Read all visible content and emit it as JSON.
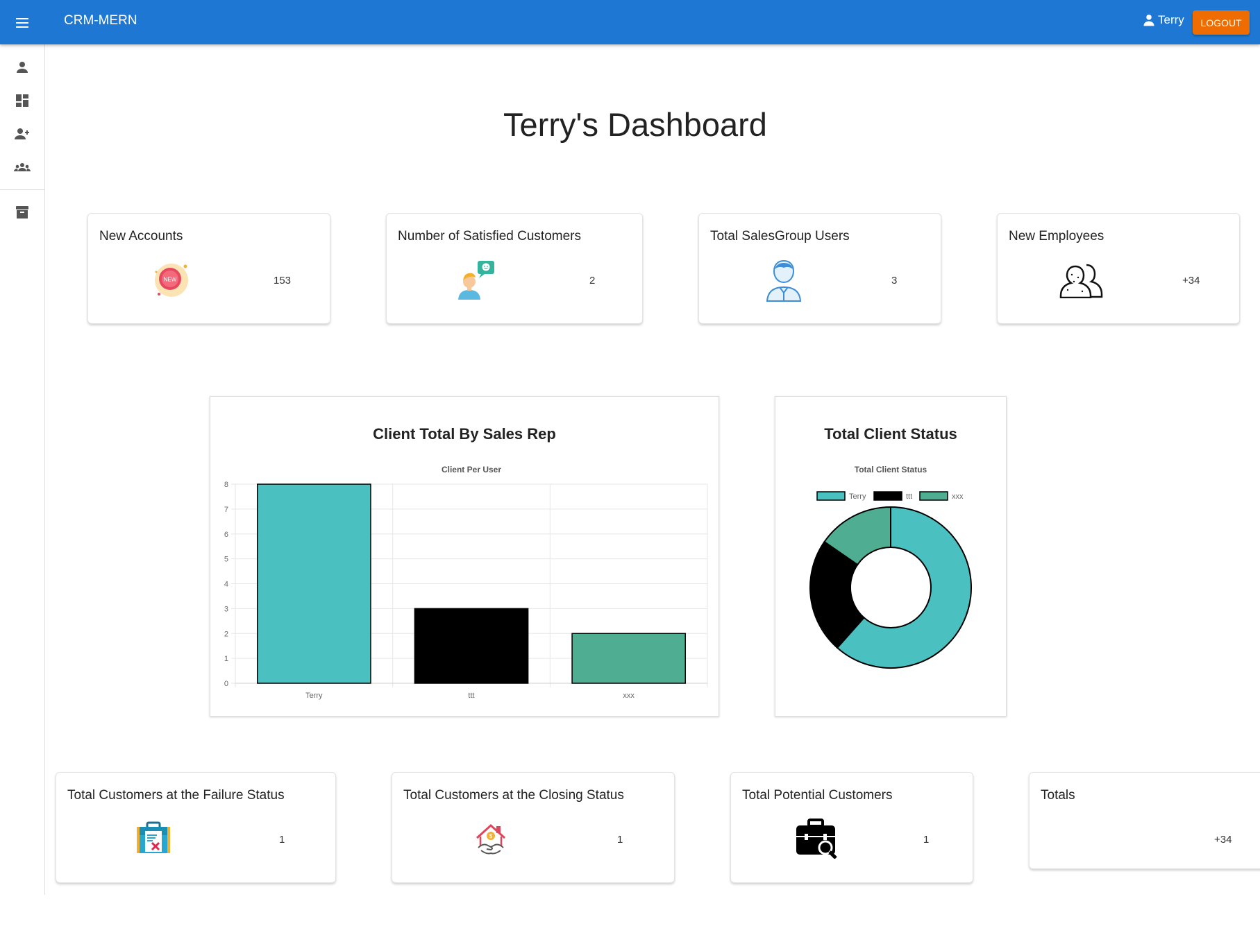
{
  "app": {
    "title": "CRM-MERN",
    "user_name": "Terry",
    "logout_label": "LOGOUT",
    "brand_color": "#1e78d3",
    "logout_color": "#ef6c00"
  },
  "sidebar": {
    "items": [
      {
        "icon": "person-icon"
      },
      {
        "icon": "dashboard-icon"
      },
      {
        "icon": "person-add-icon"
      },
      {
        "icon": "groups-icon"
      },
      {
        "icon": "archive-icon"
      }
    ]
  },
  "page": {
    "title": "Terry's Dashboard"
  },
  "stats_top": [
    {
      "label": "New Accounts",
      "value": "153",
      "icon": "new-badge-icon"
    },
    {
      "label": "Number of Satisfied Customers",
      "value": "2",
      "icon": "satisfied-customer-icon"
    },
    {
      "label": "Total SalesGroup Users",
      "value": "3",
      "icon": "user-icon"
    },
    {
      "label": "New Employees",
      "value": "+34",
      "icon": "employees-icon"
    }
  ],
  "stats_bottom": [
    {
      "label": "Total Customers at the Failure Status",
      "value": "1",
      "icon": "failure-briefcase-icon"
    },
    {
      "label": "Total Customers at the Closing Status",
      "value": "1",
      "icon": "closing-deal-icon"
    },
    {
      "label": "Total Potential Customers",
      "value": "1",
      "icon": "potential-briefcase-icon"
    },
    {
      "label": "Totals",
      "value": "+34",
      "icon": ""
    }
  ],
  "charts": {
    "bar_heading": "Client Total By Sales Rep",
    "pie_heading": "Total Client Status"
  },
  "chart_data": [
    {
      "type": "bar",
      "title": "Client Per User",
      "categories": [
        "Terry",
        "ttt",
        "xxx"
      ],
      "values": [
        8,
        3,
        2
      ],
      "colors": [
        "#4bc0c0",
        "#000000",
        "#4fad91"
      ],
      "ylim": [
        0,
        8
      ],
      "yticks": [
        0,
        1,
        2,
        3,
        4,
        5,
        6,
        7,
        8
      ],
      "grid": true,
      "legend": "none"
    },
    {
      "type": "pie",
      "title": "Total Client Status",
      "labels": [
        "Terry",
        "ttt",
        "xxx"
      ],
      "values": [
        8,
        3,
        2
      ],
      "colors": [
        "#4bc0c0",
        "#000000",
        "#4fad91"
      ],
      "legend": "top"
    }
  ]
}
